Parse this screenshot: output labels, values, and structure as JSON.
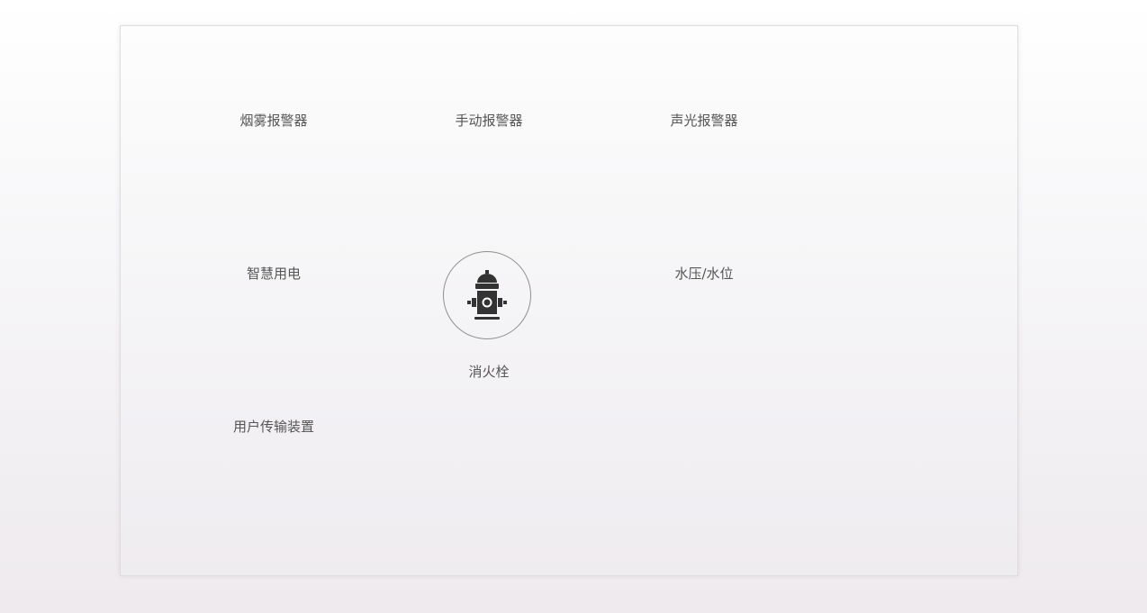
{
  "devices": [
    {
      "name": "smoke-alarm",
      "label": "烟雾报警器"
    },
    {
      "name": "manual-alarm",
      "label": "手动报警器"
    },
    {
      "name": "sound-light-alarm",
      "label": "声光报警器"
    },
    {
      "name": "smart-electricity",
      "label": "智慧用电"
    },
    {
      "name": "water-pressure-level",
      "label": "水压/水位"
    },
    {
      "name": "fire-hydrant",
      "label": "消火栓",
      "icon": "fire-hydrant-icon"
    },
    {
      "name": "user-transmission-device",
      "label": "用户传输装置"
    }
  ],
  "colors": {
    "text": "#555555",
    "icon": "#333333",
    "circle_border": "#8f8f8f"
  }
}
